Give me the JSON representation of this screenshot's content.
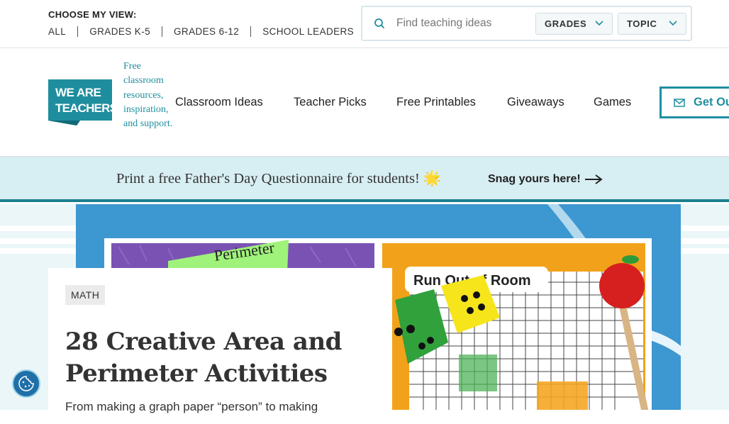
{
  "view_selector": {
    "title": "CHOOSE MY VIEW:",
    "links": [
      "ALL",
      "GRADES K-5",
      "GRADES 6-12",
      "SCHOOL LEADERS"
    ]
  },
  "search": {
    "placeholder": "Find teaching ideas",
    "grades_label": "GRADES",
    "topic_label": "TOPIC"
  },
  "brand": {
    "logo_text_1": "WE ARE",
    "logo_text_2": "TEACHERS",
    "tagline": "Free classroom resources, inspiration, and support.",
    "color": "#1e8e9e"
  },
  "nav": {
    "items": [
      "Classroom Ideas",
      "Teacher Picks",
      "Free Printables",
      "Giveaways",
      "Games"
    ],
    "cta_label": "Get Ou"
  },
  "promo": {
    "text": "Print a free Father's Day Questionnaire for students! 🌟",
    "link": "Snag yours here!"
  },
  "hero": {
    "image_caption": "Run Out of Room",
    "image_label": "Perimeter"
  },
  "article": {
    "tag": "MATH",
    "title": "28 Creative Area and Perimeter Activities",
    "excerpt": "From making a graph paper “person” to making"
  },
  "icons": [
    "search-icon",
    "chevron-down-icon",
    "mail-icon",
    "arrow-right-icon",
    "cookie-icon"
  ]
}
